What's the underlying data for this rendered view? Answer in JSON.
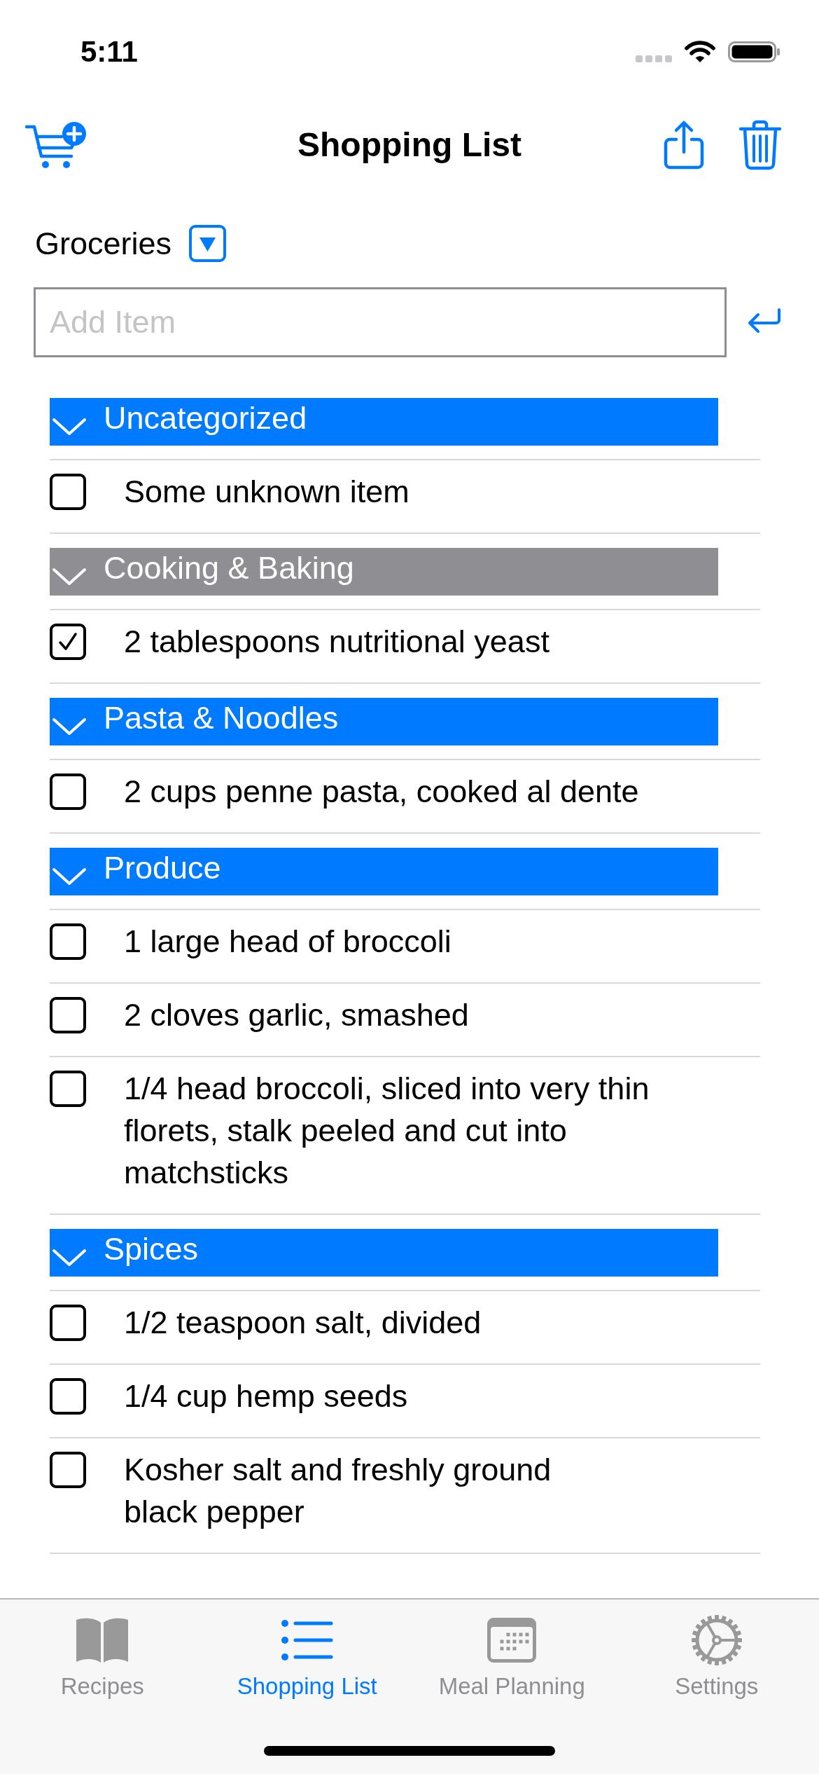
{
  "status_bar": {
    "time": "5:11"
  },
  "nav_bar": {
    "title": "Shopping List"
  },
  "list_picker": {
    "label": "Groceries"
  },
  "add_item": {
    "placeholder": "Add Item"
  },
  "sections": [
    {
      "title": "Uncategorized",
      "color": "#007aff",
      "expanded": true,
      "items": [
        {
          "text": "Some unknown item",
          "checked": false
        }
      ]
    },
    {
      "title": "Cooking & Baking",
      "color": "#8e8e93",
      "expanded": true,
      "items": [
        {
          "text": "2 tablespoons nutritional yeast",
          "checked": true
        }
      ]
    },
    {
      "title": "Pasta & Noodles",
      "color": "#007aff",
      "expanded": true,
      "items": [
        {
          "text": "2 cups penne pasta, cooked al dente",
          "checked": false
        }
      ]
    },
    {
      "title": "Produce",
      "color": "#007aff",
      "expanded": true,
      "items": [
        {
          "text": "1 large head of broccoli",
          "checked": false
        },
        {
          "text": "2 cloves garlic, smashed",
          "checked": false
        },
        {
          "text": "1/4 head broccoli, sliced into very thin\nflorets, stalk peeled and cut into\nmatchsticks",
          "checked": false
        }
      ]
    },
    {
      "title": "Spices",
      "color": "#007aff",
      "expanded": true,
      "items": [
        {
          "text": "1/2 teaspoon salt, divided",
          "checked": false
        },
        {
          "text": "1/4 cup hemp seeds",
          "checked": false
        },
        {
          "text": "Kosher salt and freshly ground\nblack pepper",
          "checked": false
        }
      ]
    }
  ],
  "tab_bar": {
    "tabs": [
      {
        "label": "Recipes",
        "selected": false
      },
      {
        "label": "Shopping List",
        "selected": true
      },
      {
        "label": "Meal Planning",
        "selected": false
      },
      {
        "label": "Settings",
        "selected": false
      }
    ]
  }
}
